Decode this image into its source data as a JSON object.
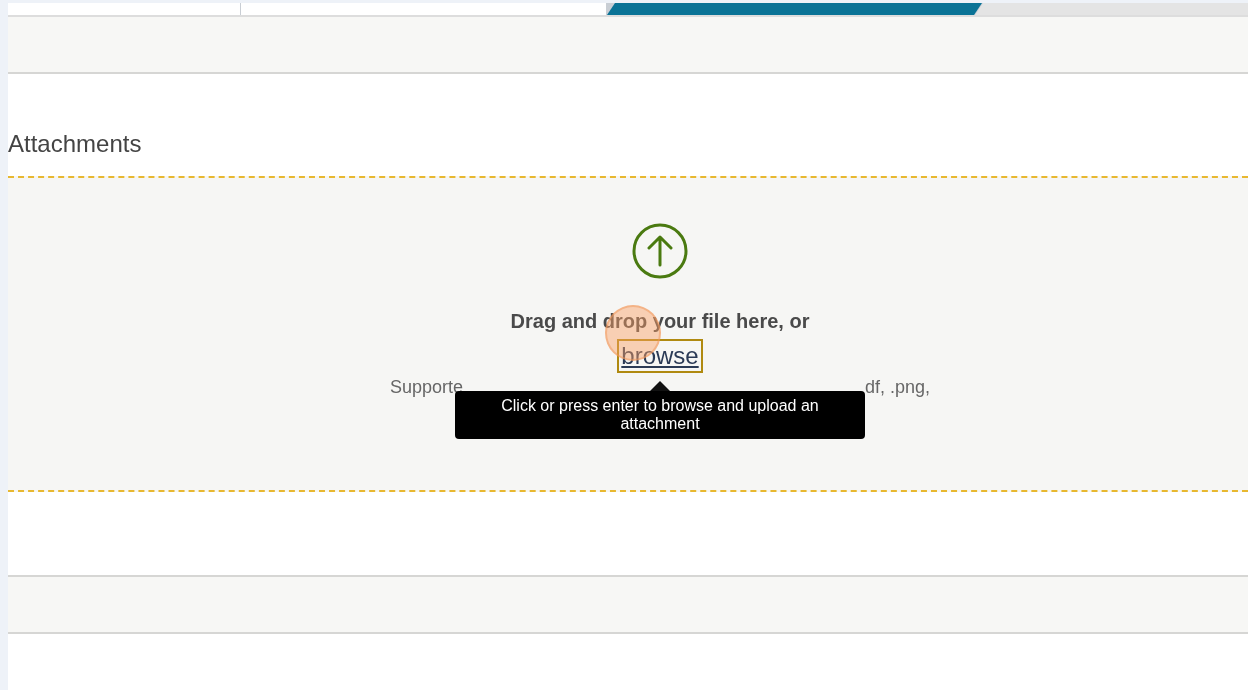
{
  "progress_steps": [
    {
      "kind": "complete"
    },
    {
      "kind": "complete"
    },
    {
      "kind": "current"
    },
    {
      "kind": "upcoming"
    }
  ],
  "section": {
    "title": "Attachments"
  },
  "dropzone": {
    "prompt": "Drag and drop your file here, or",
    "link": "browse",
    "link_focused": true,
    "supported_left": "Supporte",
    "supported_right": "df, .png,"
  },
  "tooltip": {
    "text": "Click or press enter to browse and upload an attachment"
  }
}
